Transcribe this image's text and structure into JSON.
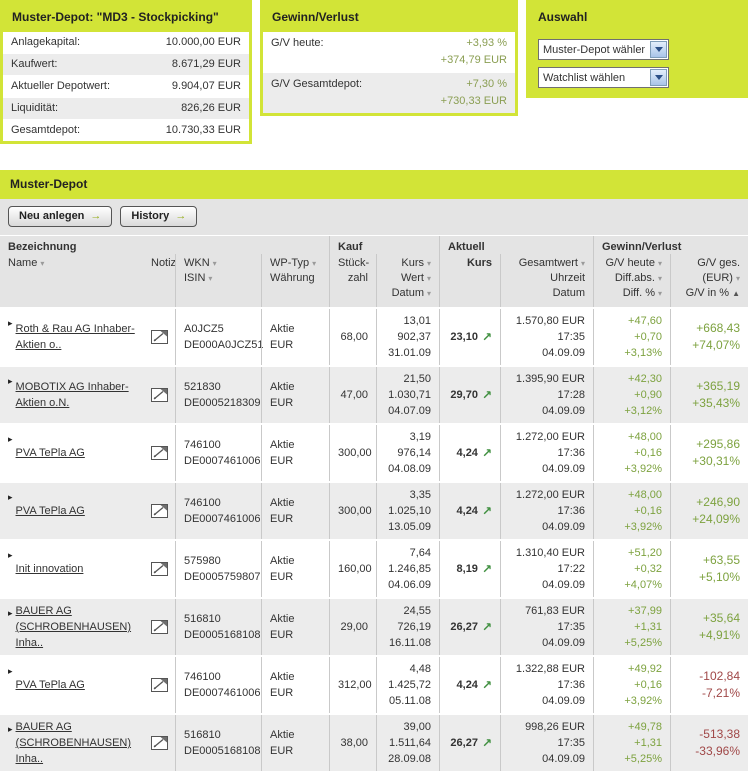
{
  "colors": {
    "accent": "#d2e437",
    "positive": "#7da23f",
    "negative": "#a04848"
  },
  "icons": {
    "sort_desc": "▾",
    "sort_asc": "▲",
    "row_arrow": "▸",
    "trend_up": "↗",
    "button_arrow": "→",
    "note": "note-icon"
  },
  "panels": {
    "depot": {
      "title": "Muster-Depot: \"MD3 - Stockpicking\"",
      "rows": [
        {
          "label": "Anlagekapital:",
          "value": "10.000,00 EUR"
        },
        {
          "label": "Kaufwert:",
          "value": "8.671,29 EUR"
        },
        {
          "label": "Aktueller Depotwert:",
          "value": "9.904,07 EUR"
        },
        {
          "label": "Liquidität:",
          "value": "826,26 EUR"
        },
        {
          "label": "Gesamtdepot:",
          "value": "10.730,33 EUR"
        }
      ]
    },
    "gv": {
      "title": "Gewinn/Verlust",
      "rows": [
        {
          "label": "G/V heute:",
          "pct": "+3,93 %",
          "eur": "+374,79 EUR"
        },
        {
          "label": "G/V Gesamtdepot:",
          "pct": "+7,30 %",
          "eur": "+730,33 EUR"
        }
      ]
    },
    "auswahl": {
      "title": "Auswahl",
      "select_depot": "Muster-Depot wählen",
      "select_watchlist": "Watchlist wählen"
    }
  },
  "section": {
    "title": "Muster-Depot",
    "buttons": [
      {
        "label": "Neu anlegen"
      },
      {
        "label": "History"
      }
    ]
  },
  "table": {
    "groups": {
      "bezeichnung": "Bezeichnung",
      "kauf": "Kauf",
      "aktuell": "Aktuell",
      "gv": "Gewinn/Verlust"
    },
    "head": {
      "name": "Name",
      "notiz": "Notiz",
      "wkn": "WKN",
      "isin": "ISIN",
      "wp_typ": "WP-Typ",
      "waehrung": "Währung",
      "stueck1": "Stück-",
      "stueck2": "zahl",
      "kurs": "Kurs",
      "wert": "Wert",
      "datum": "Datum",
      "kurs_akt": "Kurs",
      "gesamtwert": "Gesamtwert",
      "uhrzeit": "Uhrzeit",
      "datum2": "Datum",
      "gv_heute": "G/V heute",
      "diff_abs": "Diff.abs.",
      "diff_pct": "Diff. %",
      "gv_ges": "G/V ges.",
      "eur": "(EUR)",
      "gv_in_pct": "G/V in %"
    },
    "rows": [
      {
        "name": "Roth & Rau AG Inhaber-Aktien o..",
        "wkn": "A0JCZ5",
        "isin": "DE000A0JCZ51",
        "wp_typ": "Aktie",
        "waehrung": "EUR",
        "stueckzahl": "68,00",
        "kauf_kurs": "13,01",
        "kauf_wert": "902,37",
        "kauf_datum": "31.01.09",
        "kurs": "23,10",
        "gesamtwert": "1.570,80 EUR",
        "uhrzeit": "17:35",
        "datum": "04.09.09",
        "gv_heute": "+47,60",
        "diff_abs": "+0,70",
        "diff_pct": "+3,13%",
        "gv_ges_eur": "+668,43",
        "gv_ges_pct": "+74,07%",
        "trend_class": "pos"
      },
      {
        "name": "MOBOTIX AG Inhaber-Aktien o.N.",
        "wkn": "521830",
        "isin": "DE0005218309",
        "wp_typ": "Aktie",
        "waehrung": "EUR",
        "stueckzahl": "47,00",
        "kauf_kurs": "21,50",
        "kauf_wert": "1.030,71",
        "kauf_datum": "04.07.09",
        "kurs": "29,70",
        "gesamtwert": "1.395,90 EUR",
        "uhrzeit": "17:28",
        "datum": "04.09.09",
        "gv_heute": "+42,30",
        "diff_abs": "+0,90",
        "diff_pct": "+3,12%",
        "gv_ges_eur": "+365,19",
        "gv_ges_pct": "+35,43%",
        "trend_class": "pos"
      },
      {
        "name": "PVA TePla AG",
        "wkn": "746100",
        "isin": "DE0007461006",
        "wp_typ": "Aktie",
        "waehrung": "EUR",
        "stueckzahl": "300,00",
        "kauf_kurs": "3,19",
        "kauf_wert": "976,14",
        "kauf_datum": "04.08.09",
        "kurs": "4,24",
        "gesamtwert": "1.272,00 EUR",
        "uhrzeit": "17:36",
        "datum": "04.09.09",
        "gv_heute": "+48,00",
        "diff_abs": "+0,16",
        "diff_pct": "+3,92%",
        "gv_ges_eur": "+295,86",
        "gv_ges_pct": "+30,31%",
        "trend_class": "pos"
      },
      {
        "name": "PVA TePla AG",
        "wkn": "746100",
        "isin": "DE0007461006",
        "wp_typ": "Aktie",
        "waehrung": "EUR",
        "stueckzahl": "300,00",
        "kauf_kurs": "3,35",
        "kauf_wert": "1.025,10",
        "kauf_datum": "13.05.09",
        "kurs": "4,24",
        "gesamtwert": "1.272,00 EUR",
        "uhrzeit": "17:36",
        "datum": "04.09.09",
        "gv_heute": "+48,00",
        "diff_abs": "+0,16",
        "diff_pct": "+3,92%",
        "gv_ges_eur": "+246,90",
        "gv_ges_pct": "+24,09%",
        "trend_class": "pos"
      },
      {
        "name": "Init innovation",
        "wkn": "575980",
        "isin": "DE0005759807",
        "wp_typ": "Aktie",
        "waehrung": "EUR",
        "stueckzahl": "160,00",
        "kauf_kurs": "7,64",
        "kauf_wert": "1.246,85",
        "kauf_datum": "04.06.09",
        "kurs": "8,19",
        "gesamtwert": "1.310,40 EUR",
        "uhrzeit": "17:22",
        "datum": "04.09.09",
        "gv_heute": "+51,20",
        "diff_abs": "+0,32",
        "diff_pct": "+4,07%",
        "gv_ges_eur": "+63,55",
        "gv_ges_pct": "+5,10%",
        "trend_class": "pos"
      },
      {
        "name": "BAUER AG (SCHROBENHAUSEN) Inha..",
        "wkn": "516810",
        "isin": "DE0005168108",
        "wp_typ": "Aktie",
        "waehrung": "EUR",
        "stueckzahl": "29,00",
        "kauf_kurs": "24,55",
        "kauf_wert": "726,19",
        "kauf_datum": "16.11.08",
        "kurs": "26,27",
        "gesamtwert": "761,83 EUR",
        "uhrzeit": "17:35",
        "datum": "04.09.09",
        "gv_heute": "+37,99",
        "diff_abs": "+1,31",
        "diff_pct": "+5,25%",
        "gv_ges_eur": "+35,64",
        "gv_ges_pct": "+4,91%",
        "trend_class": "pos"
      },
      {
        "name": "PVA TePla AG",
        "wkn": "746100",
        "isin": "DE0007461006",
        "wp_typ": "Aktie",
        "waehrung": "EUR",
        "stueckzahl": "312,00",
        "kauf_kurs": "4,48",
        "kauf_wert": "1.425,72",
        "kauf_datum": "05.11.08",
        "kurs": "4,24",
        "gesamtwert": "1.322,88 EUR",
        "uhrzeit": "17:36",
        "datum": "04.09.09",
        "gv_heute": "+49,92",
        "diff_abs": "+0,16",
        "diff_pct": "+3,92%",
        "gv_ges_eur": "-102,84",
        "gv_ges_pct": "-7,21%",
        "trend_class": "neg"
      },
      {
        "name": "BAUER AG (SCHROBENHAUSEN) Inha..",
        "wkn": "516810",
        "isin": "DE0005168108",
        "wp_typ": "Aktie",
        "waehrung": "EUR",
        "stueckzahl": "38,00",
        "kauf_kurs": "39,00",
        "kauf_wert": "1.511,64",
        "kauf_datum": "28.09.08",
        "kurs": "26,27",
        "gesamtwert": "998,26 EUR",
        "uhrzeit": "17:35",
        "datum": "04.09.09",
        "gv_heute": "+49,78",
        "diff_abs": "+1,31",
        "diff_pct": "+5,25%",
        "gv_ges_eur": "-513,38",
        "gv_ges_pct": "-33,96%",
        "trend_class": "neg"
      }
    ]
  }
}
